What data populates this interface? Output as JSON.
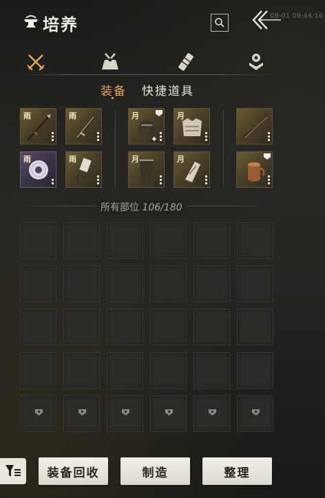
{
  "header": {
    "title": "培养",
    "clock": "09-01 09:44:16"
  },
  "category_tabs": [
    {
      "name": "weapons",
      "icon": "crossed-swords-icon",
      "active": true
    },
    {
      "name": "attire",
      "icon": "bundle-icon",
      "active": false
    },
    {
      "name": "scrolls",
      "icon": "scroll-icon",
      "active": false
    },
    {
      "name": "tokens",
      "icon": "token-icon",
      "active": false
    }
  ],
  "sub_tabs": {
    "equipment": "装备",
    "quick_items": "快捷道具"
  },
  "equipped": {
    "row1": [
      {
        "tier": "雨",
        "item": "spear-icon",
        "badge": false
      },
      {
        "tier": "雨",
        "item": "sword-icon",
        "badge": false
      },
      {
        "tier": "月",
        "item": "helmet-icon",
        "badge": true
      },
      {
        "tier": "月",
        "item": "armor-icon",
        "badge": false
      },
      {
        "tier": "",
        "item": "bow-icon",
        "badge": false
      }
    ],
    "row2": [
      {
        "tier": "雨",
        "item": "jade-disc-icon",
        "badge": false
      },
      {
        "tier": "雨",
        "item": "talisman-icon",
        "badge": false
      },
      {
        "tier": "月",
        "item": "leggings-icon",
        "badge": false
      },
      {
        "tier": "月",
        "item": "bracers-icon",
        "badge": false
      },
      {
        "tier": "",
        "item": "gourd-icon",
        "badge": true
      }
    ]
  },
  "inventory": {
    "label": "所有部位",
    "count": "106/180"
  },
  "actions": {
    "recycle": "装备回收",
    "craft": "制造",
    "sort": "整理"
  },
  "colors": {
    "accent": "#e6a85a",
    "button_bg": "#e9e6de"
  }
}
